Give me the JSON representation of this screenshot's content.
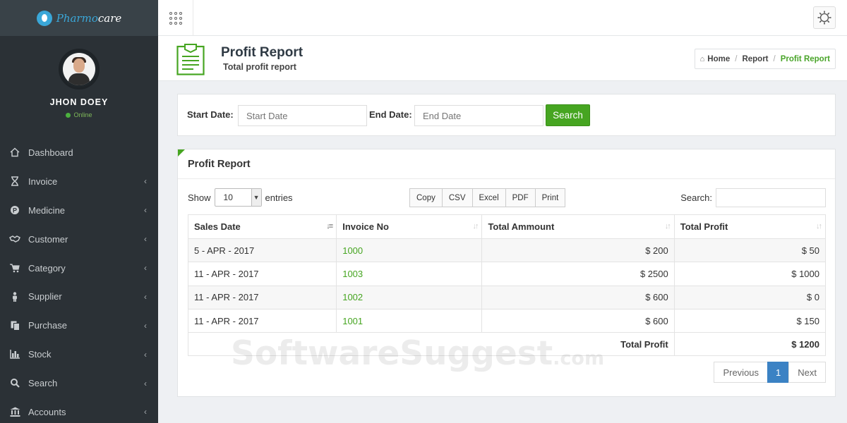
{
  "brand": {
    "name_part1": "Pharmo",
    "name_part2": "care"
  },
  "user": {
    "name": "JHON DOEY",
    "status": "Online"
  },
  "sidebar": {
    "items": [
      {
        "label": "Dashboard",
        "icon": "home-icon",
        "has_submenu": false
      },
      {
        "label": "Invoice",
        "icon": "hourglass-icon",
        "has_submenu": true
      },
      {
        "label": "Medicine",
        "icon": "pill-icon",
        "has_submenu": true
      },
      {
        "label": "Customer",
        "icon": "handshake-icon",
        "has_submenu": true
      },
      {
        "label": "Category",
        "icon": "cart-icon",
        "has_submenu": true
      },
      {
        "label": "Supplier",
        "icon": "person-icon",
        "has_submenu": true
      },
      {
        "label": "Purchase",
        "icon": "copy-icon",
        "has_submenu": true
      },
      {
        "label": "Stock",
        "icon": "bar-chart-icon",
        "has_submenu": true
      },
      {
        "label": "Search",
        "icon": "search-icon",
        "has_submenu": true
      },
      {
        "label": "Accounts",
        "icon": "bank-icon",
        "has_submenu": true
      }
    ]
  },
  "header": {
    "title": "Profit Report",
    "subtitle": "Total profit report",
    "breadcrumb": [
      "Home",
      "Report",
      "Profit Report"
    ]
  },
  "filter": {
    "start_label": "Start Date:",
    "start_placeholder": "Start Date",
    "end_label": "End Date:",
    "end_placeholder": "End Date",
    "search_button": "Search"
  },
  "report": {
    "title": "Profit Report",
    "show_label": "Show",
    "entries_value": "10",
    "entries_label": "entries",
    "export_buttons": [
      "Copy",
      "CSV",
      "Excel",
      "PDF",
      "Print"
    ],
    "search_label": "Search:",
    "columns": [
      "Sales Date",
      "Invoice No",
      "Total Ammount",
      "Total Profit"
    ],
    "rows": [
      {
        "date": "5 - APR - 2017",
        "invoice": "1000",
        "amount": "$ 200",
        "profit": "$ 50"
      },
      {
        "date": "11 - APR - 2017",
        "invoice": "1003",
        "amount": "$ 2500",
        "profit": "$ 1000"
      },
      {
        "date": "11 - APR - 2017",
        "invoice": "1002",
        "amount": "$ 600",
        "profit": "$ 0"
      },
      {
        "date": "11 - APR - 2017",
        "invoice": "1001",
        "amount": "$ 600",
        "profit": "$ 150"
      }
    ],
    "footer_label": "Total Profit",
    "footer_total": "$ 1200",
    "pagination": {
      "previous": "Previous",
      "current": "1",
      "next": "Next"
    }
  },
  "watermark": {
    "text": "SoftwareSuggest",
    "suffix": ".com"
  },
  "colors": {
    "accent_green": "#46a521",
    "sidebar_bg": "#2b3136",
    "page_active_blue": "#3b82c4"
  }
}
